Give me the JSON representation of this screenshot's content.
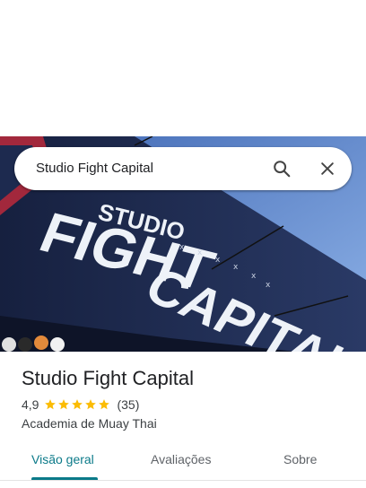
{
  "search": {
    "query": "Studio Fight Capital"
  },
  "hero": {
    "sign_line1": "STUDIO",
    "sign_line2": "FIGHT",
    "sign_line3": "CAPITAL"
  },
  "place": {
    "name": "Studio Fight Capital",
    "rating": "4,9",
    "stars": 5,
    "review_count": "(35)",
    "category": "Academia de Muay Thai"
  },
  "tabs": [
    {
      "label": "Visão geral",
      "active": true
    },
    {
      "label": "Avaliações",
      "active": false
    },
    {
      "label": "Sobre",
      "active": false
    }
  ],
  "colors": {
    "accent": "#0b7a89",
    "star": "#fbbc04",
    "sky": "#5a7fc4",
    "sign_navy": "#1d2a4f"
  }
}
